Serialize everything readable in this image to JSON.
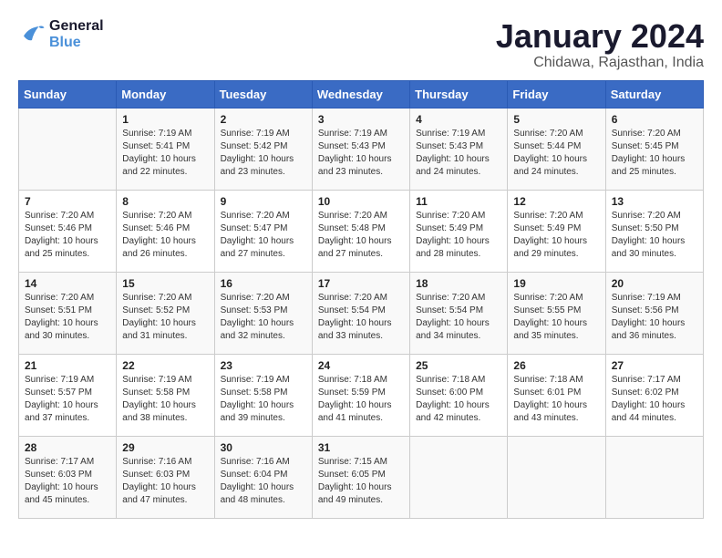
{
  "header": {
    "logo_line1": "General",
    "logo_line2": "Blue",
    "month_title": "January 2024",
    "location": "Chidawa, Rajasthan, India"
  },
  "weekdays": [
    "Sunday",
    "Monday",
    "Tuesday",
    "Wednesday",
    "Thursday",
    "Friday",
    "Saturday"
  ],
  "weeks": [
    [
      {
        "day": "",
        "info": ""
      },
      {
        "day": "1",
        "info": "Sunrise: 7:19 AM\nSunset: 5:41 PM\nDaylight: 10 hours\nand 22 minutes."
      },
      {
        "day": "2",
        "info": "Sunrise: 7:19 AM\nSunset: 5:42 PM\nDaylight: 10 hours\nand 23 minutes."
      },
      {
        "day": "3",
        "info": "Sunrise: 7:19 AM\nSunset: 5:43 PM\nDaylight: 10 hours\nand 23 minutes."
      },
      {
        "day": "4",
        "info": "Sunrise: 7:19 AM\nSunset: 5:43 PM\nDaylight: 10 hours\nand 24 minutes."
      },
      {
        "day": "5",
        "info": "Sunrise: 7:20 AM\nSunset: 5:44 PM\nDaylight: 10 hours\nand 24 minutes."
      },
      {
        "day": "6",
        "info": "Sunrise: 7:20 AM\nSunset: 5:45 PM\nDaylight: 10 hours\nand 25 minutes."
      }
    ],
    [
      {
        "day": "7",
        "info": "Sunrise: 7:20 AM\nSunset: 5:46 PM\nDaylight: 10 hours\nand 25 minutes."
      },
      {
        "day": "8",
        "info": "Sunrise: 7:20 AM\nSunset: 5:46 PM\nDaylight: 10 hours\nand 26 minutes."
      },
      {
        "day": "9",
        "info": "Sunrise: 7:20 AM\nSunset: 5:47 PM\nDaylight: 10 hours\nand 27 minutes."
      },
      {
        "day": "10",
        "info": "Sunrise: 7:20 AM\nSunset: 5:48 PM\nDaylight: 10 hours\nand 27 minutes."
      },
      {
        "day": "11",
        "info": "Sunrise: 7:20 AM\nSunset: 5:49 PM\nDaylight: 10 hours\nand 28 minutes."
      },
      {
        "day": "12",
        "info": "Sunrise: 7:20 AM\nSunset: 5:49 PM\nDaylight: 10 hours\nand 29 minutes."
      },
      {
        "day": "13",
        "info": "Sunrise: 7:20 AM\nSunset: 5:50 PM\nDaylight: 10 hours\nand 30 minutes."
      }
    ],
    [
      {
        "day": "14",
        "info": "Sunrise: 7:20 AM\nSunset: 5:51 PM\nDaylight: 10 hours\nand 30 minutes."
      },
      {
        "day": "15",
        "info": "Sunrise: 7:20 AM\nSunset: 5:52 PM\nDaylight: 10 hours\nand 31 minutes."
      },
      {
        "day": "16",
        "info": "Sunrise: 7:20 AM\nSunset: 5:53 PM\nDaylight: 10 hours\nand 32 minutes."
      },
      {
        "day": "17",
        "info": "Sunrise: 7:20 AM\nSunset: 5:54 PM\nDaylight: 10 hours\nand 33 minutes."
      },
      {
        "day": "18",
        "info": "Sunrise: 7:20 AM\nSunset: 5:54 PM\nDaylight: 10 hours\nand 34 minutes."
      },
      {
        "day": "19",
        "info": "Sunrise: 7:20 AM\nSunset: 5:55 PM\nDaylight: 10 hours\nand 35 minutes."
      },
      {
        "day": "20",
        "info": "Sunrise: 7:19 AM\nSunset: 5:56 PM\nDaylight: 10 hours\nand 36 minutes."
      }
    ],
    [
      {
        "day": "21",
        "info": "Sunrise: 7:19 AM\nSunset: 5:57 PM\nDaylight: 10 hours\nand 37 minutes."
      },
      {
        "day": "22",
        "info": "Sunrise: 7:19 AM\nSunset: 5:58 PM\nDaylight: 10 hours\nand 38 minutes."
      },
      {
        "day": "23",
        "info": "Sunrise: 7:19 AM\nSunset: 5:58 PM\nDaylight: 10 hours\nand 39 minutes."
      },
      {
        "day": "24",
        "info": "Sunrise: 7:18 AM\nSunset: 5:59 PM\nDaylight: 10 hours\nand 41 minutes."
      },
      {
        "day": "25",
        "info": "Sunrise: 7:18 AM\nSunset: 6:00 PM\nDaylight: 10 hours\nand 42 minutes."
      },
      {
        "day": "26",
        "info": "Sunrise: 7:18 AM\nSunset: 6:01 PM\nDaylight: 10 hours\nand 43 minutes."
      },
      {
        "day": "27",
        "info": "Sunrise: 7:17 AM\nSunset: 6:02 PM\nDaylight: 10 hours\nand 44 minutes."
      }
    ],
    [
      {
        "day": "28",
        "info": "Sunrise: 7:17 AM\nSunset: 6:03 PM\nDaylight: 10 hours\nand 45 minutes."
      },
      {
        "day": "29",
        "info": "Sunrise: 7:16 AM\nSunset: 6:03 PM\nDaylight: 10 hours\nand 47 minutes."
      },
      {
        "day": "30",
        "info": "Sunrise: 7:16 AM\nSunset: 6:04 PM\nDaylight: 10 hours\nand 48 minutes."
      },
      {
        "day": "31",
        "info": "Sunrise: 7:15 AM\nSunset: 6:05 PM\nDaylight: 10 hours\nand 49 minutes."
      },
      {
        "day": "",
        "info": ""
      },
      {
        "day": "",
        "info": ""
      },
      {
        "day": "",
        "info": ""
      }
    ]
  ]
}
